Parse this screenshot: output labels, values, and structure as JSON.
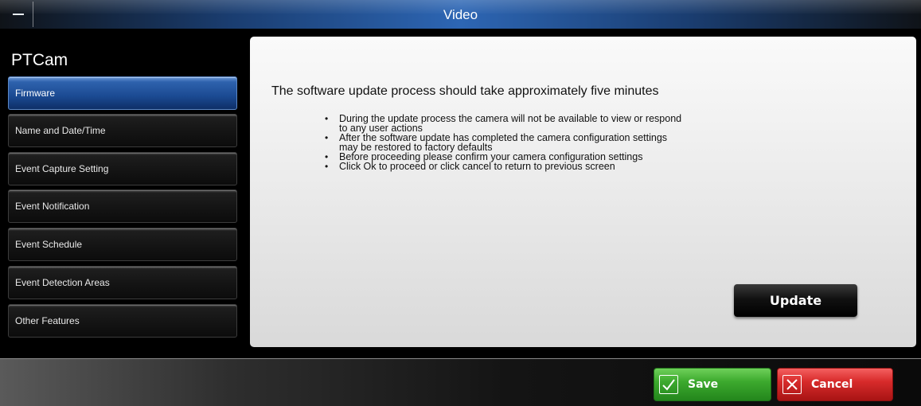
{
  "window": {
    "title": "Video",
    "minimize_icon": "minimize-icon"
  },
  "sidebar": {
    "app_name": "PTCam",
    "items": [
      {
        "label": "Firmware",
        "active": true
      },
      {
        "label": "Name and Date/Time",
        "active": false
      },
      {
        "label": "Event Capture Setting",
        "active": false
      },
      {
        "label": "Event Notification",
        "active": false
      },
      {
        "label": "Event Schedule",
        "active": false
      },
      {
        "label": "Event Detection Areas",
        "active": false
      },
      {
        "label": "Other Features",
        "active": false
      }
    ]
  },
  "main": {
    "headline": "The software update process should take approximately five minutes",
    "bullets": [
      {
        "line1": "During the update process the camera will not be available to view or respond",
        "line2": "to any user actions"
      },
      {
        "line1": "After the software update has completed the camera configuration settings",
        "line2": "may be restored to factory defaults"
      },
      {
        "line1": "Before proceeding please confirm your camera configuration settings",
        "line2": ""
      },
      {
        "line1": "Click Ok to proceed or click cancel to return to previous screen",
        "line2": ""
      }
    ],
    "update_label": "Update"
  },
  "footer": {
    "save_label": "Save",
    "save_icon": "checkmark-icon",
    "cancel_label": "Cancel",
    "cancel_icon": "x-icon"
  },
  "colors": {
    "accent_blue": "#1b4a92",
    "save_green": "#3daa2e",
    "cancel_red": "#d82b2b"
  }
}
